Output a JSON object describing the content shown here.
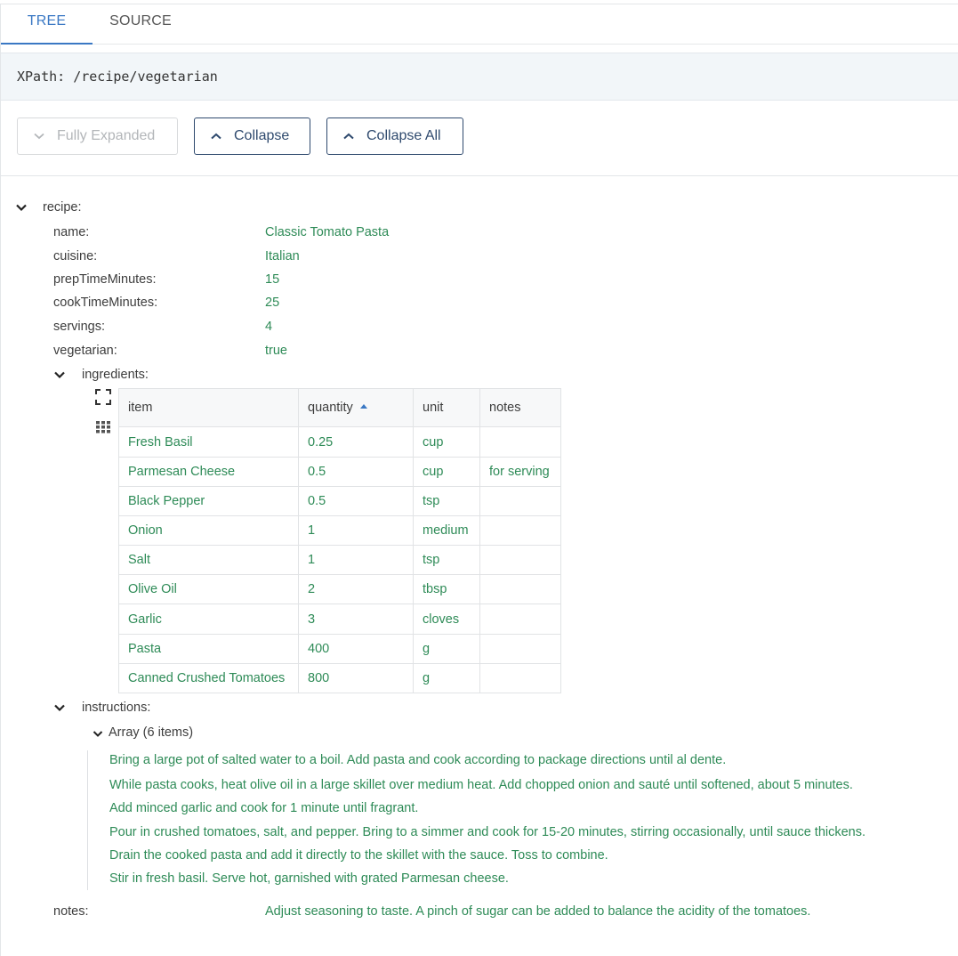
{
  "tabs": [
    {
      "label": "TREE",
      "active": true
    },
    {
      "label": "SOURCE",
      "active": false
    }
  ],
  "xpath": "XPath: /recipe/vegetarian",
  "toolbar": {
    "fully_expanded_label": "Fully Expanded",
    "collapse_label": "Collapse",
    "collapse_all_label": "Collapse All"
  },
  "tree": {
    "root_label": "recipe:",
    "fields": [
      {
        "key": "name:",
        "value": "Classic Tomato Pasta"
      },
      {
        "key": "cuisine:",
        "value": "Italian"
      },
      {
        "key": "prepTimeMinutes:",
        "value": "15"
      },
      {
        "key": "cookTimeMinutes:",
        "value": "25"
      },
      {
        "key": "servings:",
        "value": "4"
      },
      {
        "key": "vegetarian:",
        "value": "true"
      }
    ],
    "ingredients_label": "ingredients:",
    "ingredients": {
      "columns": [
        "item",
        "quantity",
        "unit",
        "notes"
      ],
      "sorted_column": "quantity",
      "sort_direction": "ascending",
      "rows": [
        [
          "Fresh Basil",
          "0.25",
          "cup",
          ""
        ],
        [
          "Parmesan Cheese",
          "0.5",
          "cup",
          "for serving"
        ],
        [
          "Black Pepper",
          "0.5",
          "tsp",
          ""
        ],
        [
          "Onion",
          "1",
          "medium",
          ""
        ],
        [
          "Salt",
          "1",
          "tsp",
          ""
        ],
        [
          "Olive Oil",
          "2",
          "tbsp",
          ""
        ],
        [
          "Garlic",
          "3",
          "cloves",
          ""
        ],
        [
          "Pasta",
          "400",
          "g",
          ""
        ],
        [
          "Canned Crushed Tomatoes",
          "800",
          "g",
          ""
        ]
      ]
    },
    "instructions_label": "instructions:",
    "instructions_array_label": "Array (6 items)",
    "instructions": [
      "Bring a large pot of salted water to a boil. Add pasta and cook according to package directions until al dente.",
      "While pasta cooks, heat olive oil in a large skillet over medium heat. Add chopped onion and sauté until softened, about 5 minutes.",
      "Add minced garlic and cook for 1 minute until fragrant.",
      "Pour in crushed tomatoes, salt, and pepper. Bring to a simmer and cook for 15-20 minutes, stirring occasionally, until sauce thickens.",
      "Drain the cooked pasta and add it directly to the skillet with the sauce. Toss to combine.",
      "Stir in fresh basil. Serve hot, garnished with grated Parmesan cheese."
    ],
    "notes_label": "notes:",
    "notes_value": "Adjust seasoning to taste. A pinch of sugar can be added to balance the acidity of the tomatoes."
  },
  "colors": {
    "accent": "#3a78c4",
    "value_text": "#2e8b57",
    "button_border": "#2f4a6e"
  }
}
